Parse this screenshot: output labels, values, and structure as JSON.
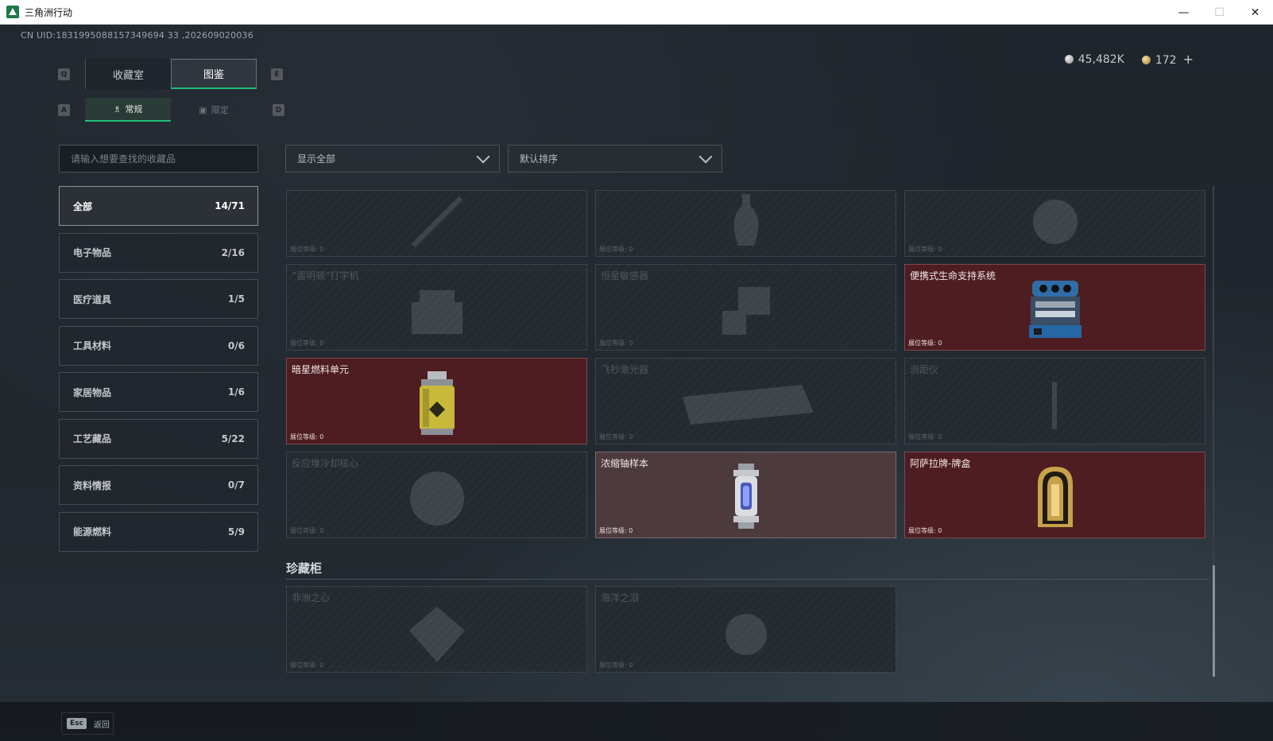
{
  "window": {
    "title": "三角洲行动",
    "minimize": "—",
    "maximize": "☐",
    "close": "✕"
  },
  "uid": "CN UID:1831995088157349694 33 ,202609020036",
  "currency": {
    "silver": "45,482K",
    "gold": "172",
    "plus": "+"
  },
  "keys": {
    "q": "Q",
    "e": "E",
    "a": "A",
    "d": "D",
    "esc": "Esc"
  },
  "tabs": [
    {
      "label": "收藏室",
      "active": false
    },
    {
      "label": "图鉴",
      "active": true
    }
  ],
  "subtabs": [
    {
      "label": "常规",
      "active": true
    },
    {
      "label": "限定",
      "active": false
    }
  ],
  "search": {
    "placeholder": "请输入想要查找的收藏品"
  },
  "categories": [
    {
      "label": "全部",
      "count": "14/71",
      "active": true
    },
    {
      "label": "电子物品",
      "count": "2/16"
    },
    {
      "label": "医疗道具",
      "count": "1/5"
    },
    {
      "label": "工具材料",
      "count": "0/6"
    },
    {
      "label": "家居物品",
      "count": "1/6"
    },
    {
      "label": "工艺藏品",
      "count": "5/22"
    },
    {
      "label": "资料情报",
      "count": "0/7"
    },
    {
      "label": "能源燃料",
      "count": "5/9"
    }
  ],
  "filters": {
    "show": "显示全部",
    "sort": "默认排序"
  },
  "items": [
    {
      "name": "",
      "level": "展位等级: 0",
      "owned": false,
      "icon": "gun-barrel-icon"
    },
    {
      "name": "",
      "level": "展位等级: 0",
      "owned": false,
      "icon": "vase-icon"
    },
    {
      "name": "",
      "level": "展位等级: 0",
      "owned": false,
      "icon": "skull-icon"
    },
    {
      "name": "“雷明顿”打字机",
      "level": "展位等级: 0",
      "owned": false,
      "icon": "typewriter-icon"
    },
    {
      "name": "恒星敏感器",
      "level": "展位等级: 0",
      "owned": false,
      "icon": "sensor-icon"
    },
    {
      "name": "便携式生命支持系统",
      "level": "展位等级: 0",
      "owned": true,
      "icon": "life-support-icon"
    },
    {
      "name": "暗星燃料单元",
      "level": "展位等级: 0",
      "owned": true,
      "icon": "fuel-cell-icon"
    },
    {
      "name": "飞秒激光器",
      "level": "展位等级: 0",
      "owned": false,
      "icon": "laser-icon"
    },
    {
      "name": "测距仪",
      "level": "展位等级: 0",
      "owned": false,
      "icon": "rangefinder-icon"
    },
    {
      "name": "反应堆冷却核心",
      "level": "展位等级: 0",
      "owned": false,
      "icon": "reactor-core-icon"
    },
    {
      "name": "浓缩铀样本",
      "level": "展位等级: 0",
      "owned": true,
      "gray": true,
      "icon": "uranium-canister-icon"
    },
    {
      "name": "阿萨拉牌-牌盒",
      "level": "展位等级: 0",
      "owned": true,
      "icon": "card-box-icon"
    }
  ],
  "section": {
    "title": "珍藏柜"
  },
  "treasures": [
    {
      "name": "非洲之心",
      "level": "展位等级: 0",
      "icon": "diamond-icon"
    },
    {
      "name": "海洋之泪",
      "level": "展位等级: 0",
      "icon": "pearl-icon"
    }
  ],
  "bottom": {
    "back": "返回"
  },
  "colors": {
    "accent": "#1fbf7a",
    "owned_card": "#4e1d21",
    "owned_card_gray": "#4d3a3d"
  }
}
